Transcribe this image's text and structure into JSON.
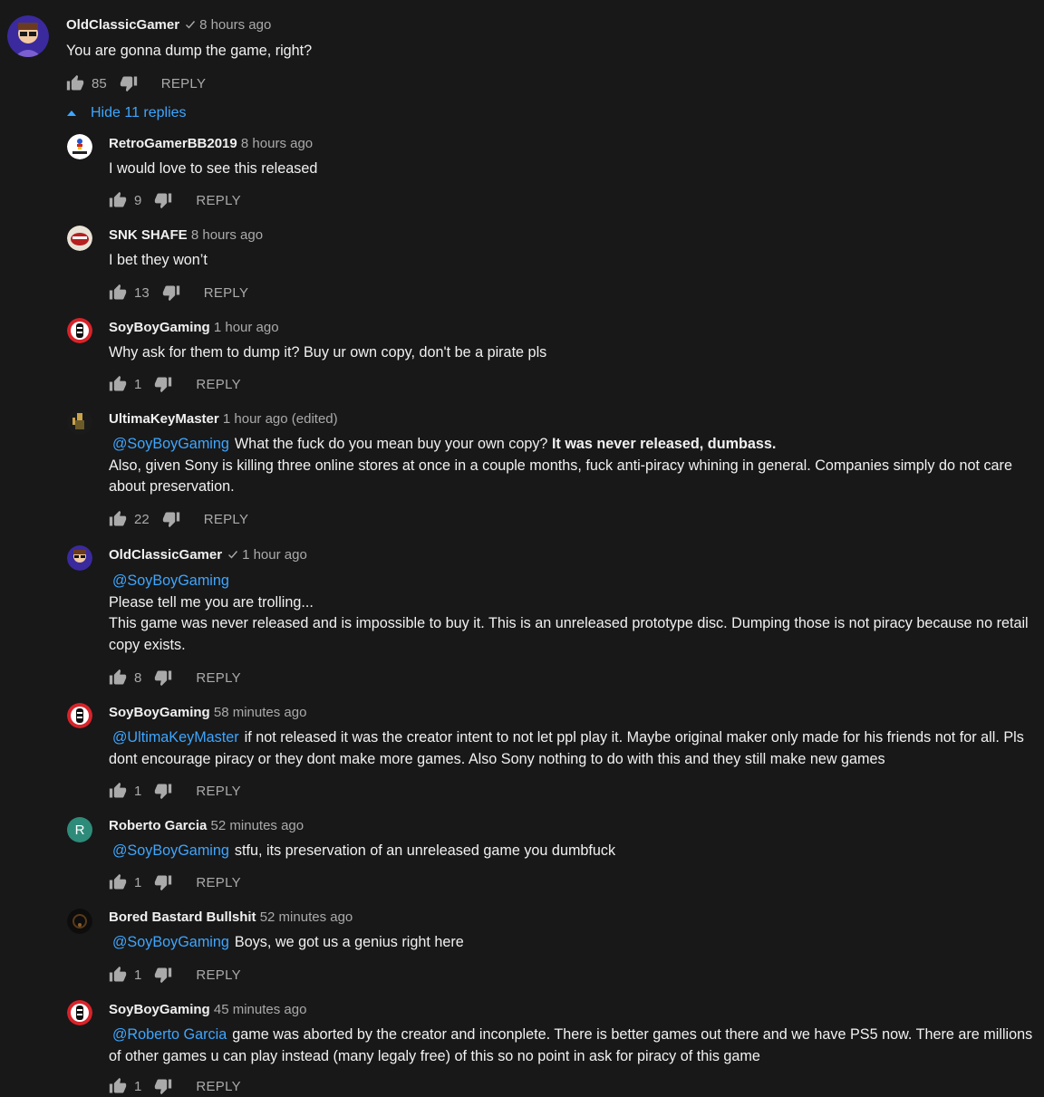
{
  "top": {
    "author": "OldClassicGamer",
    "time": "8 hours ago",
    "text": "You are gonna dump the game, right?",
    "likes": "85",
    "reply": "REPLY",
    "toggle": "Hide 11 replies"
  },
  "replies": [
    {
      "author": "RetroGamerBB2019",
      "time": "8 hours ago",
      "text": "I would love to see this released",
      "likes": "9",
      "reply": "REPLY"
    },
    {
      "author": "SNK SHAFE",
      "time": "8 hours ago",
      "text": "I bet they won’t",
      "likes": "13",
      "reply": "REPLY"
    },
    {
      "author": "SoyBoyGaming",
      "time": "1 hour ago",
      "text": "Why ask for them to dump it? Buy ur own copy, don't be a pirate pls",
      "likes": "1",
      "reply": "REPLY"
    },
    {
      "author": "UltimaKeyMaster",
      "time": "1 hour ago (edited)",
      "mention": "@SoyBoyGaming",
      "text1": "What the fuck do you mean buy your own copy?  ",
      "bold": "It was never released, dumbass.",
      "text2": "Also, given Sony is killing three online stores at once in a couple months, fuck anti-piracy whining in general.  Companies simply do not care about preservation.",
      "likes": "22",
      "reply": "REPLY"
    },
    {
      "author": "OldClassicGamer",
      "time": "1 hour ago",
      "mention": "@SoyBoyGaming",
      "line1": "Please tell me you are trolling...",
      "line2": "This game was never released and is impossible to buy it. This is an unreleased prototype disc. Dumping those is not piracy because no retail copy exists.",
      "likes": "8",
      "reply": "REPLY"
    },
    {
      "author": "SoyBoyGaming",
      "time": "58 minutes ago",
      "mention": "@UltimaKeyMaster",
      "text": "if not released it was the creator intent to not let ppl play it. Maybe original maker only made for his friends not for all. Pls dont encourage piracy or they dont make more games. Also Sony nothing to do with this and they still make new games",
      "likes": "1",
      "reply": "REPLY"
    },
    {
      "author": "Roberto Garcia",
      "time": "52 minutes ago",
      "avatar_letter": "R",
      "mention": "@SoyBoyGaming",
      "text": "stfu, its preservation of an unreleased game you dumbfuck",
      "likes": "1",
      "reply": "REPLY"
    },
    {
      "author": "Bored Bastard Bullshit",
      "time": "52 minutes ago",
      "mention": "@SoyBoyGaming",
      "text": "Boys, we got us a genius right here",
      "likes": "1",
      "reply": "REPLY"
    },
    {
      "author": "SoyBoyGaming",
      "time": "45 minutes ago",
      "mention": "@Roberto Garcia",
      "text": "game was aborted by the creator and inconplete. There is better games out there and we have PS5 now. There are millions of other games u can play instead (many legaly free) of this so no point in ask for piracy of this game",
      "likes": "1",
      "reply": "REPLY"
    }
  ]
}
